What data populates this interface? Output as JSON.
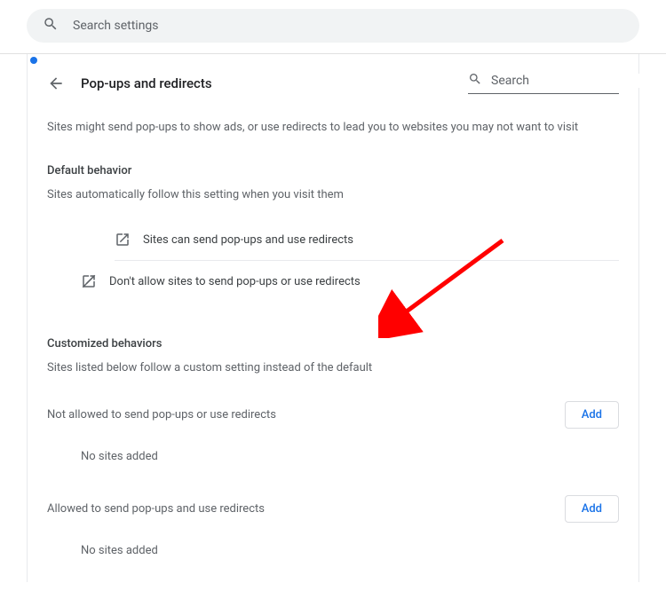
{
  "top_search": {
    "placeholder": "Search settings"
  },
  "header": {
    "title": "Pop-ups and redirects",
    "search_placeholder": "Search"
  },
  "description": "Sites might send pop-ups to show ads, or use redirects to lead you to websites you may not want to visit",
  "default_behavior": {
    "title": "Default behavior",
    "subtitle": "Sites automatically follow this setting when you visit them",
    "options": [
      {
        "label": "Sites can send pop-ups and use redirects"
      },
      {
        "label": "Don't allow sites to send pop-ups or use redirects"
      }
    ]
  },
  "customized": {
    "title": "Customized behaviors",
    "subtitle": "Sites listed below follow a custom setting instead of the default",
    "not_allowed": {
      "label": "Not allowed to send pop-ups or use redirects",
      "button": "Add",
      "empty": "No sites added"
    },
    "allowed": {
      "label": "Allowed to send pop-ups and use redirects",
      "button": "Add",
      "empty": "No sites added"
    }
  }
}
